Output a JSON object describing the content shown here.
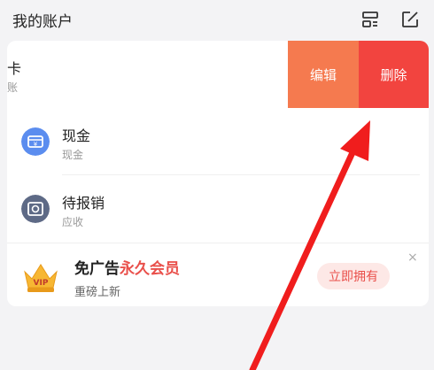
{
  "header": {
    "title": "我的账户"
  },
  "swiped_item": {
    "title_fragment": "卡",
    "sub_fragment": "账",
    "edit_label": "编辑",
    "delete_label": "删除"
  },
  "accounts": [
    {
      "name": "现金",
      "type": "现金",
      "icon": "cash-icon",
      "color": "#5b8def"
    },
    {
      "name": "待报销",
      "type": "应收",
      "icon": "receivable-icon",
      "color": "#5e6a86"
    }
  ],
  "vip_banner": {
    "title_main": "免广告",
    "title_accent": "永久会员",
    "subtitle": "重磅上新",
    "action_label": "立即拥有",
    "close_label": "×",
    "badge_text": "VIP"
  },
  "colors": {
    "edit": "#f57a4f",
    "delete": "#f2443f",
    "accent": "#e94f4a",
    "annotation_arrow": "#f01d1d"
  }
}
